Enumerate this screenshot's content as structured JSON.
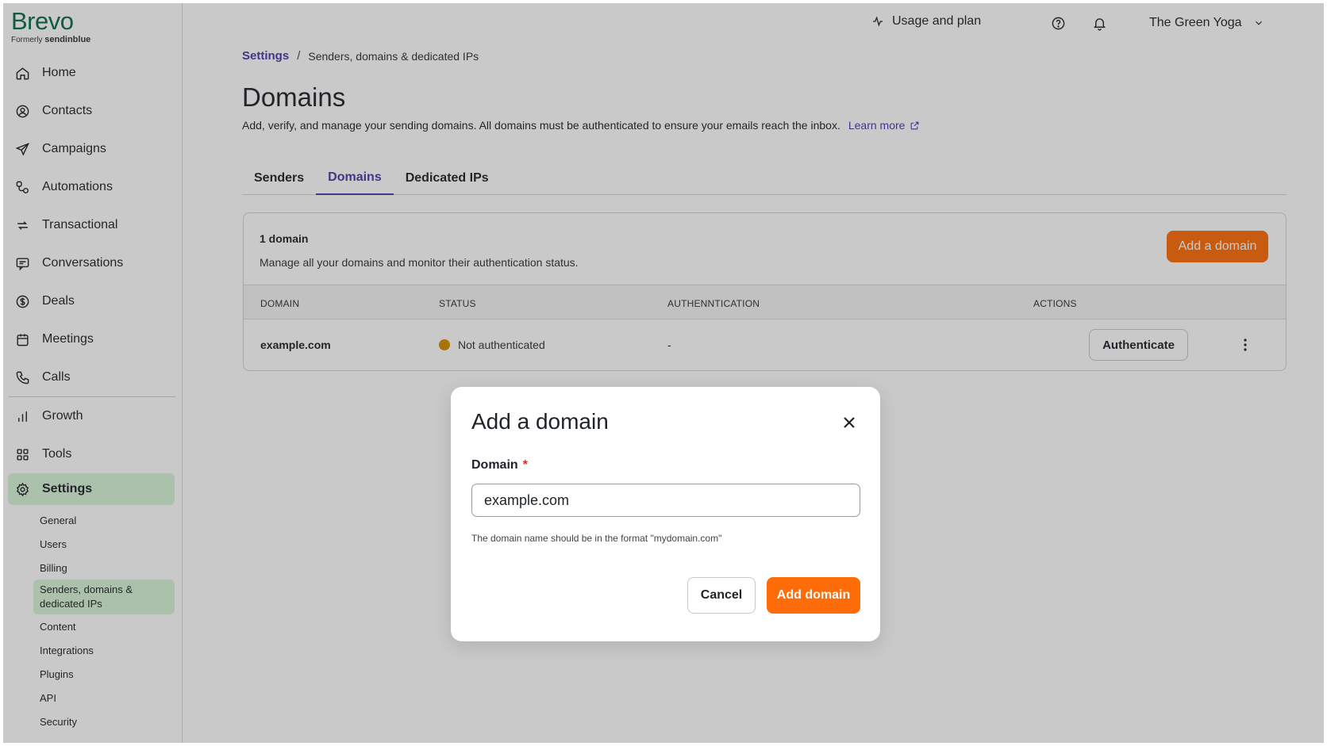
{
  "brand": {
    "name": "Brevo",
    "formerly": "Formerly",
    "formerly_brand": "sendinblue"
  },
  "sidebar": {
    "items": [
      {
        "label": "Home",
        "icon": "home-icon"
      },
      {
        "label": "Contacts",
        "icon": "contacts-icon"
      },
      {
        "label": "Campaigns",
        "icon": "send-icon"
      },
      {
        "label": "Automations",
        "icon": "automation-icon"
      },
      {
        "label": "Transactional",
        "icon": "refresh-icon"
      },
      {
        "label": "Conversations",
        "icon": "chat-icon"
      },
      {
        "label": "Deals",
        "icon": "dollar-icon"
      },
      {
        "label": "Meetings",
        "icon": "calendar-icon"
      },
      {
        "label": "Calls",
        "icon": "phone-icon"
      },
      {
        "label": "Growth",
        "icon": "bar-chart-icon"
      },
      {
        "label": "Tools",
        "icon": "grid-icon"
      },
      {
        "label": "Settings",
        "icon": "gear-icon"
      }
    ],
    "settings_sub": [
      "General",
      "Users",
      "Billing",
      "Senders, domains & dedicated IPs",
      "Content",
      "Integrations",
      "Plugins",
      "API",
      "Security"
    ]
  },
  "topbar": {
    "usage": "Usage and plan",
    "account": "The Green Yoga"
  },
  "breadcrumb": {
    "root": "Settings",
    "sep": "/",
    "current": "Senders, domains & dedicated IPs"
  },
  "page": {
    "title": "Domains",
    "description": "Add, verify, and manage your sending domains. All domains must be authenticated to ensure your emails reach the inbox.",
    "learn_more": "Learn more"
  },
  "tabs": [
    "Senders",
    "Domains",
    "Dedicated IPs"
  ],
  "card": {
    "title": "1 domain",
    "subtitle": "Manage all your domains and monitor their authentication status.",
    "add_button": "Add a domain",
    "columns": [
      "DOMAIN",
      "STATUS",
      "AUTHENNTICATION",
      "ACTIONS"
    ],
    "rows": [
      {
        "domain": "example.com",
        "status": "Not authenticated",
        "authentication": "-",
        "action": "Authenticate"
      }
    ]
  },
  "modal": {
    "title": "Add a domain",
    "field_label": "Domain",
    "required_mark": "*",
    "field_value": "example.com",
    "help": "The domain name should be in the format \"mydomain.com\"",
    "cancel": "Cancel",
    "submit": "Add domain"
  },
  "colors": {
    "accent": "#4a3aa8",
    "cta": "#ff6d0a",
    "brand": "#0b6b4b",
    "active_nav": "#d9f5d9",
    "status_warning": "#d48b00"
  }
}
